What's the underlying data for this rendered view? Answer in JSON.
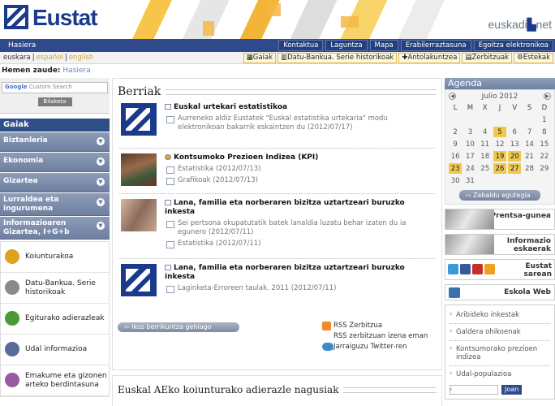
{
  "header": {
    "brand": "Eustat",
    "portal": "euskadi",
    "portal_suffix": "net"
  },
  "nav1": {
    "home": "Hasiera",
    "tabs": [
      "Kontaktua",
      "Laguntza",
      "Mapa",
      "Erabilerraztasuna",
      "Egoitza elektronikoa"
    ]
  },
  "nav2": {
    "langs": [
      "euskara",
      "español",
      "english"
    ],
    "tools": [
      "Gaiak",
      "Datu-Bankua. Serie historikoak",
      "Antolakuntzea",
      "Zerbitzuak",
      "Estekak"
    ]
  },
  "breadcrumb": {
    "label": "Hemen zaude:",
    "path": "Hasiera"
  },
  "search": {
    "placeholder": "Custom Search",
    "google": "Google",
    "button": "Bilaketa"
  },
  "gaiak": {
    "title": "Gaiak",
    "items": [
      "Biztanleria",
      "Ekonomia",
      "Gizartea",
      "Lurraldea eta ingurumena",
      "Informazioaren Gizartea, I+G+b"
    ]
  },
  "quick": [
    "Koiunturakoa",
    "Datu-Bankua. Serie historikoak",
    "Egiturako adierazleak",
    "Udal informazioa",
    "Emakume eta gizonen arteko berdintasuna"
  ],
  "news": {
    "title": "Berriak",
    "items": [
      {
        "title": "Euskal urtekari estatistikoa",
        "lines": [
          "Aurreneko aldiz Eustatek \"Euskal estatistika urtekaria\" modu elektronikoan bakarrik eskaintzen du (2012/07/17)"
        ]
      },
      {
        "title": "Kontsumoko Prezioen Indizea (KPI)",
        "lines": [
          "Estatistika (2012/07/13)",
          "Grafikoak (2012/07/13)"
        ]
      },
      {
        "title": "Lana, familia eta norberaren bizitza uztartzeari buruzko inkesta",
        "lines": [
          "Sei pertsona okupatutatik batek lanaldia luzatu behar izaten du ia egunero (2012/07/11)",
          "Estatistika (2012/07/11)"
        ]
      },
      {
        "title": "Lana, familia eta norberaren bizitza uztartzeari buruzko inkesta",
        "lines": [
          "Laginketa-Erroreen taulak. 2011 (2012/07/11)"
        ]
      }
    ],
    "more": "›› Ikus berrikuntza gehiago",
    "rss": "RSS Zerbitzua",
    "rss_sub": "RSS zerbitzuan izena eman",
    "twitter": "Jarraiguzu Twitter-ren"
  },
  "sec2": {
    "title": "Euskal AEko koiunturako adierazle nagusiak"
  },
  "agenda": {
    "title": "Agenda",
    "month": "Julio 2012",
    "days": [
      "L",
      "M",
      "X",
      "J",
      "V",
      "S",
      "D"
    ],
    "weeks": [
      [
        "",
        "",
        "",
        "",
        "",
        "",
        "1"
      ],
      [
        "2",
        "3",
        "4",
        "5",
        "6",
        "7",
        "8"
      ],
      [
        "9",
        "10",
        "11",
        "12",
        "13",
        "14",
        "15"
      ],
      [
        "16",
        "17",
        "18",
        "19",
        "20",
        "21",
        "22"
      ],
      [
        "23",
        "24",
        "25",
        "26",
        "27",
        "28",
        "29"
      ],
      [
        "30",
        "31",
        "",
        "",
        "",
        "",
        ""
      ]
    ],
    "button": "›› Zabaldu egutegia"
  },
  "right": {
    "press": "Prentsa-gunea",
    "reports": [
      "Informazio",
      "eskaerak"
    ],
    "social": [
      "Eustat",
      "sarean"
    ],
    "eweb": "Eskola Web",
    "links": [
      "Aribideko inkestak",
      "Galdera ohikoenak",
      "Kontsumorako prezioen indizea",
      "Udal-populazioa"
    ],
    "go": "Joan"
  }
}
